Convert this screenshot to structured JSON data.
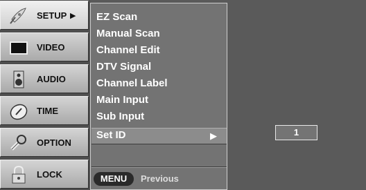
{
  "sidebar": {
    "items": [
      {
        "label": "SETUP",
        "icon": "satellite-dish-icon",
        "active": true,
        "arrow": "▶"
      },
      {
        "label": "VIDEO",
        "icon": "tv-screen-icon",
        "active": false
      },
      {
        "label": "AUDIO",
        "icon": "speaker-icon",
        "active": false
      },
      {
        "label": "TIME",
        "icon": "clock-icon",
        "active": false
      },
      {
        "label": "OPTION",
        "icon": "wrench-icon",
        "active": false
      },
      {
        "label": "LOCK",
        "icon": "padlock-icon",
        "active": false
      }
    ]
  },
  "submenu": {
    "items": [
      {
        "label": "EZ Scan"
      },
      {
        "label": "Manual Scan"
      },
      {
        "label": "Channel Edit"
      },
      {
        "label": "DTV Signal"
      },
      {
        "label": "Channel Label"
      },
      {
        "label": "Main Input"
      },
      {
        "label": "Sub Input"
      },
      {
        "label": "Set ID",
        "selected": true
      }
    ],
    "selected_arrow": "▶",
    "menu_key": "MENU",
    "previous_label": "Previous"
  },
  "set_id": {
    "value": "1"
  },
  "colors": {
    "background": "#5a5a5a",
    "panel": "#737373",
    "selected_row": "#8c8c8c"
  }
}
